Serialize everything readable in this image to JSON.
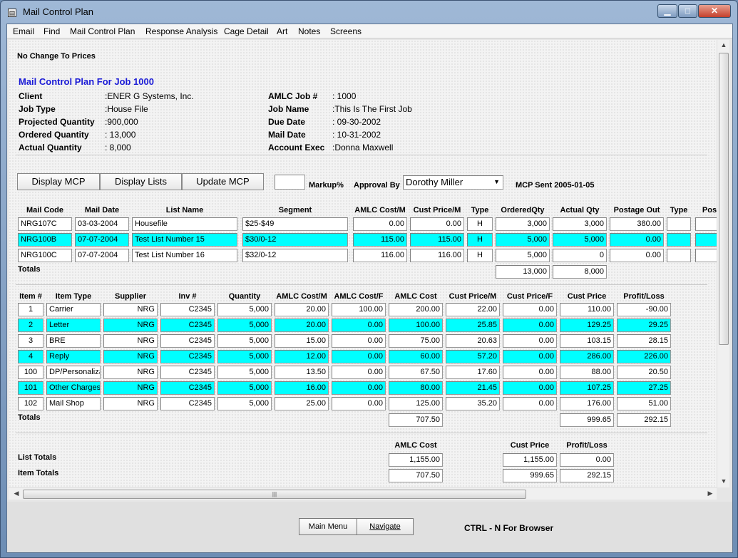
{
  "window": {
    "title": "Mail Control Plan"
  },
  "menu": [
    "Email",
    "Find",
    "Mail Control Plan",
    "Response Analysis",
    "Cage Detail",
    "Art",
    "Notes",
    "Screens"
  ],
  "notice": "No Change To Prices",
  "plan_title": "Mail Control Plan For Job 1000",
  "left_info": [
    {
      "label": "Client",
      "value": ":ENER G Systems, Inc."
    },
    {
      "label": "Job Type",
      "value": ":House File"
    },
    {
      "label": "Projected Quantity",
      "value": ":900,000"
    },
    {
      "label": "Ordered Quantity",
      "value": ": 13,000"
    },
    {
      "label": "Actual Quantity",
      "value": ": 8,000"
    }
  ],
  "right_info": [
    {
      "label": "AMLC Job #",
      "value": ": 1000"
    },
    {
      "label": "Job Name",
      "value": ":This Is The First Job"
    },
    {
      "label": "Due Date",
      "value": ": 09-30-2002"
    },
    {
      "label": "Mail Date",
      "value": ": 10-31-2002"
    },
    {
      "label": "Account Exec",
      "value": ":Donna Maxwell"
    }
  ],
  "buttons": {
    "display_mcp": "Display MCP",
    "display_lists": "Display Lists",
    "update_mcp": "Update MCP"
  },
  "markup": {
    "label": "Markup%",
    "value": ""
  },
  "approval": {
    "label": "Approval By",
    "value": "Dorothy Miller"
  },
  "mcp_sent": "MCP Sent 2005-01-05",
  "lists": {
    "headers": [
      "Mail Code",
      "Mail Date",
      "List Name",
      "Segment",
      "AMLC Cost/M",
      "Cust Price/M",
      "Type",
      "OrderedQty",
      "Actual Qty",
      "Postage Out",
      "Type",
      "Pos"
    ],
    "rows": [
      {
        "code": "NRG107C",
        "date": "03-03-2004",
        "name": "Housefile",
        "segment": "$25-$49",
        "amlc": "0.00",
        "cust": "0.00",
        "type": "H",
        "ordered": "3,000",
        "actual": "3,000",
        "postage": "380.00",
        "type2": "",
        "pos": "",
        "hl": false
      },
      {
        "code": "NRG100B",
        "date": "07-07-2004",
        "name": "Test List Number 15",
        "segment": "$30/0-12",
        "amlc": "115.00",
        "cust": "115.00",
        "type": "H",
        "ordered": "5,000",
        "actual": "5,000",
        "postage": "0.00",
        "type2": "",
        "pos": "",
        "hl": true
      },
      {
        "code": "NRG100C",
        "date": "07-07-2004",
        "name": "Test List Number 16",
        "segment": "$32/0-12",
        "amlc": "116.00",
        "cust": "116.00",
        "type": "H",
        "ordered": "5,000",
        "actual": "0",
        "postage": "0.00",
        "type2": "",
        "pos": "",
        "hl": false
      }
    ],
    "totals_label": "Totals",
    "totals": {
      "ordered": "13,000",
      "actual": "8,000"
    }
  },
  "items": {
    "headers": [
      "Item #",
      "Item Type",
      "Supplier",
      "Inv #",
      "Quantity",
      "AMLC Cost/M",
      "AMLC Cost/F",
      "AMLC Cost",
      "Cust Price/M",
      "Cust Price/F",
      "Cust Price",
      "Profit/Loss"
    ],
    "rows": [
      {
        "num": "1",
        "type": "Carrier",
        "supplier": "NRG",
        "inv": "C2345",
        "qty": "5,000",
        "costm": "20.00",
        "costf": "100.00",
        "cost": "200.00",
        "pricem": "22.00",
        "pricef": "0.00",
        "price": "110.00",
        "pl": "-90.00",
        "hl": false
      },
      {
        "num": "2",
        "type": "Letter",
        "supplier": "NRG",
        "inv": "C2345",
        "qty": "5,000",
        "costm": "20.00",
        "costf": "0.00",
        "cost": "100.00",
        "pricem": "25.85",
        "pricef": "0.00",
        "price": "129.25",
        "pl": "29.25",
        "hl": true
      },
      {
        "num": "3",
        "type": "BRE",
        "supplier": "NRG",
        "inv": "C2345",
        "qty": "5,000",
        "costm": "15.00",
        "costf": "0.00",
        "cost": "75.00",
        "pricem": "20.63",
        "pricef": "0.00",
        "price": "103.15",
        "pl": "28.15",
        "hl": false
      },
      {
        "num": "4",
        "type": "Reply",
        "supplier": "NRG",
        "inv": "C2345",
        "qty": "5,000",
        "costm": "12.00",
        "costf": "0.00",
        "cost": "60.00",
        "pricem": "57.20",
        "pricef": "0.00",
        "price": "286.00",
        "pl": "226.00",
        "hl": true
      },
      {
        "num": "100",
        "type": "DP/Personalization",
        "supplier": "NRG",
        "inv": "C2345",
        "qty": "5,000",
        "costm": "13.50",
        "costf": "0.00",
        "cost": "67.50",
        "pricem": "17.60",
        "pricef": "0.00",
        "price": "88.00",
        "pl": "20.50",
        "hl": false
      },
      {
        "num": "101",
        "type": "Other Charges",
        "supplier": "NRG",
        "inv": "C2345",
        "qty": "5,000",
        "costm": "16.00",
        "costf": "0.00",
        "cost": "80.00",
        "pricem": "21.45",
        "pricef": "0.00",
        "price": "107.25",
        "pl": "27.25",
        "hl": true
      },
      {
        "num": "102",
        "type": "Mail Shop",
        "supplier": "NRG",
        "inv": "C2345",
        "qty": "5,000",
        "costm": "25.00",
        "costf": "0.00",
        "cost": "125.00",
        "pricem": "35.20",
        "pricef": "0.00",
        "price": "176.00",
        "pl": "51.00",
        "hl": false
      }
    ],
    "totals_label": "Totals",
    "totals": {
      "cost": "707.50",
      "price": "999.65",
      "pl": "292.15"
    }
  },
  "summary": {
    "headers": {
      "amlc_cost": "AMLC Cost",
      "cust_price": "Cust Price",
      "profit_loss": "Profit/Loss"
    },
    "list_totals": {
      "label": "List Totals",
      "amlc_cost": "1,155.00",
      "cust_price": "1,155.00",
      "profit_loss": "0.00"
    },
    "item_totals": {
      "label": "Item Totals",
      "amlc_cost": "707.50",
      "cust_price": "999.65",
      "profit_loss": "292.15"
    }
  },
  "footer": {
    "main_menu": "Main Menu",
    "navigate": "Navigate",
    "hint": "CTRL - N For Browser"
  },
  "colors": {
    "highlight": "#00ffff",
    "title_blue": "#1a1ad6"
  }
}
